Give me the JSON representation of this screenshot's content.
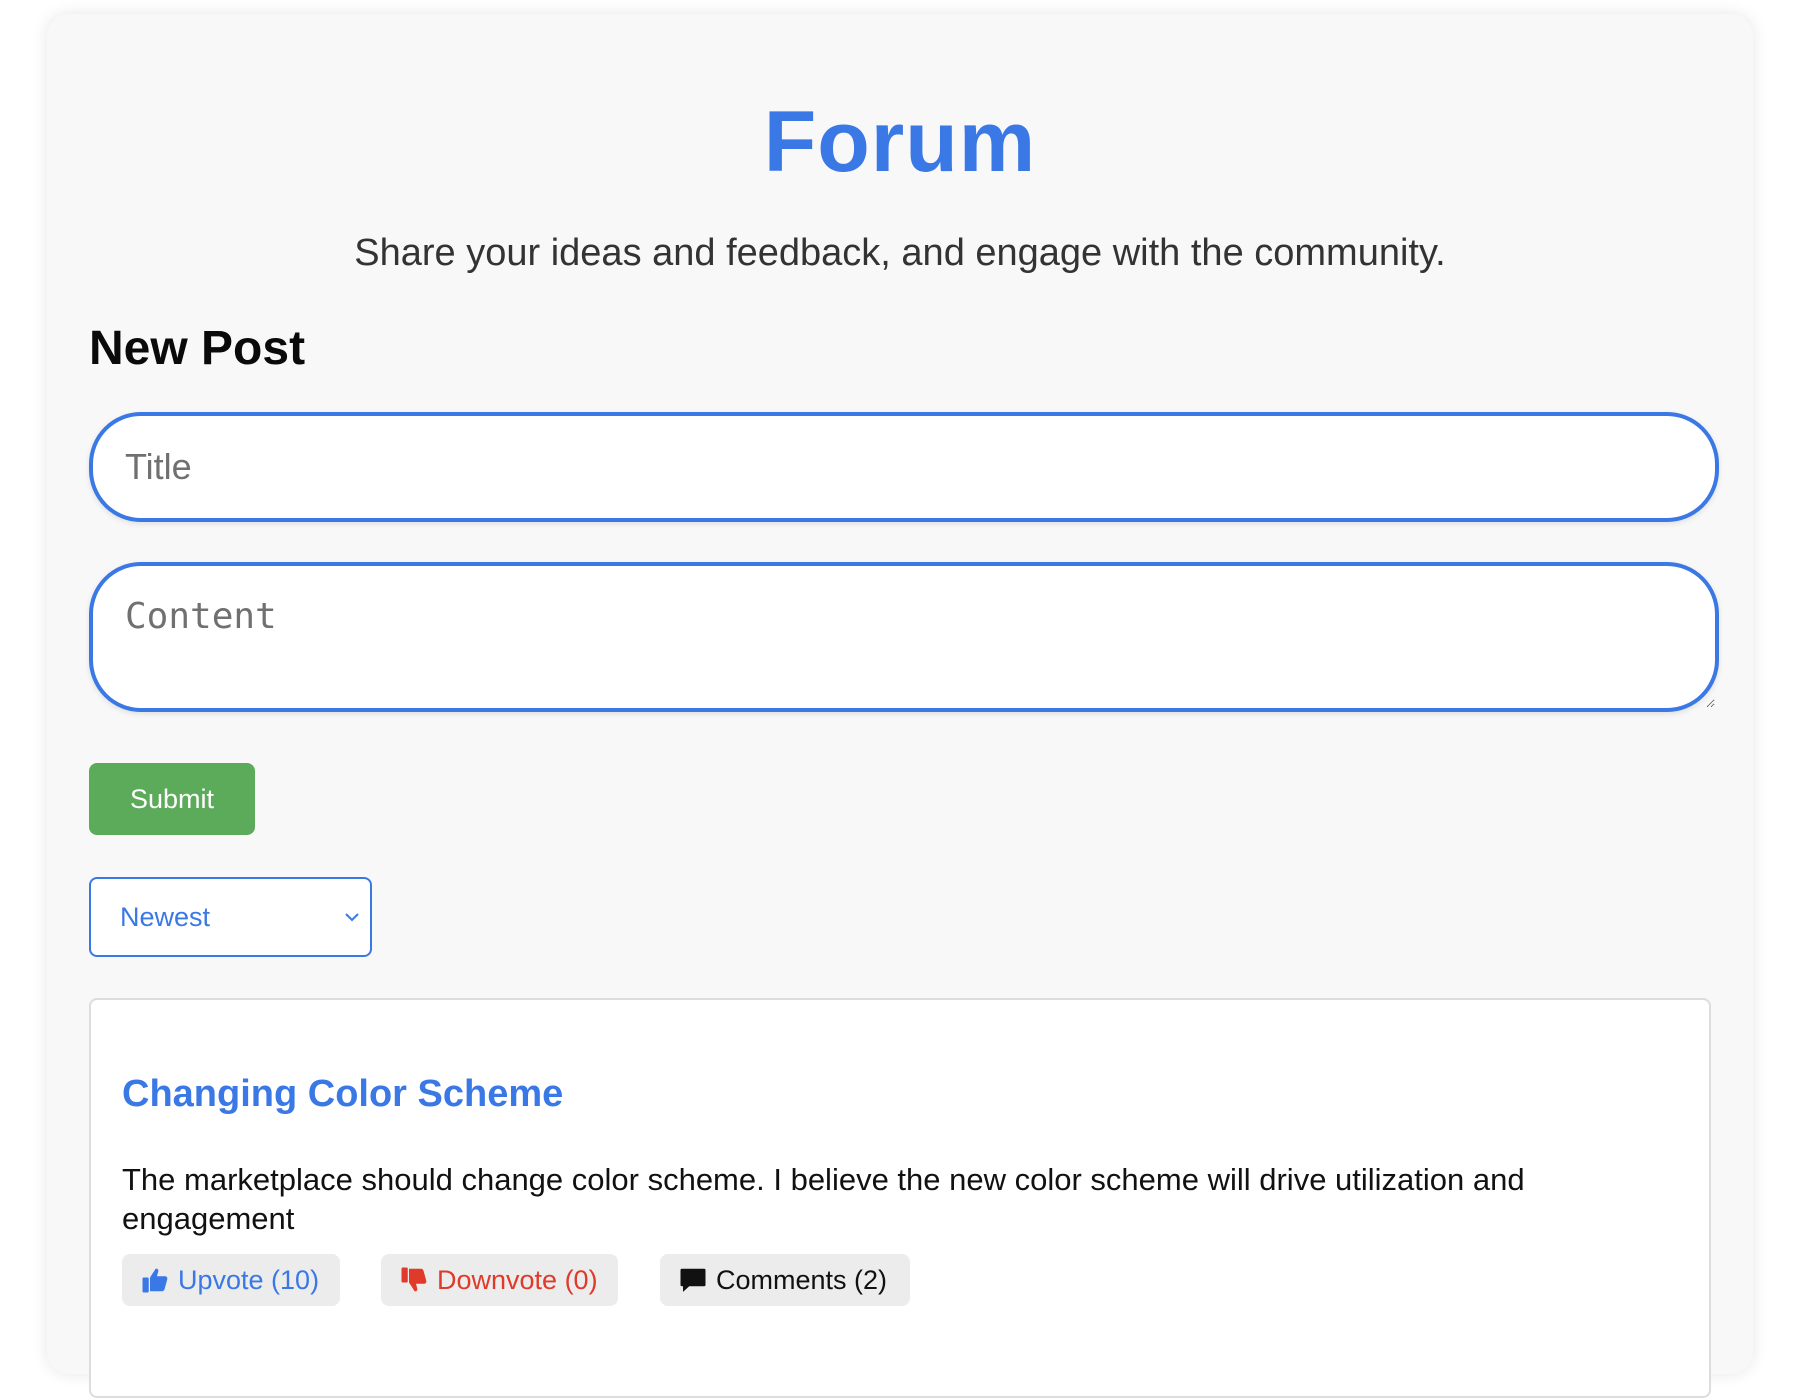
{
  "header": {
    "title": "Forum",
    "subtitle": "Share your ideas and feedback, and engage with the community."
  },
  "new_post": {
    "heading": "New Post",
    "title_placeholder": "Title",
    "content_placeholder": "Content",
    "submit_label": "Submit"
  },
  "sort": {
    "selected": "Newest"
  },
  "posts": [
    {
      "title": "Changing Color Scheme",
      "body": "The marketplace should change color scheme. I believe the new color scheme will drive utilization and engagement",
      "upvote_label": "Upvote (10)",
      "downvote_label": "Downvote (0)",
      "comments_label": "Comments (2)",
      "upvote_icon": "thumbs-up-icon",
      "downvote_icon": "thumbs-down-icon",
      "comments_icon": "comment-icon"
    }
  ],
  "colors": {
    "accent": "#3a78e6",
    "submit": "#5cab5a",
    "downvote": "#e03a2a",
    "panel_background": "#f8f8f8"
  }
}
